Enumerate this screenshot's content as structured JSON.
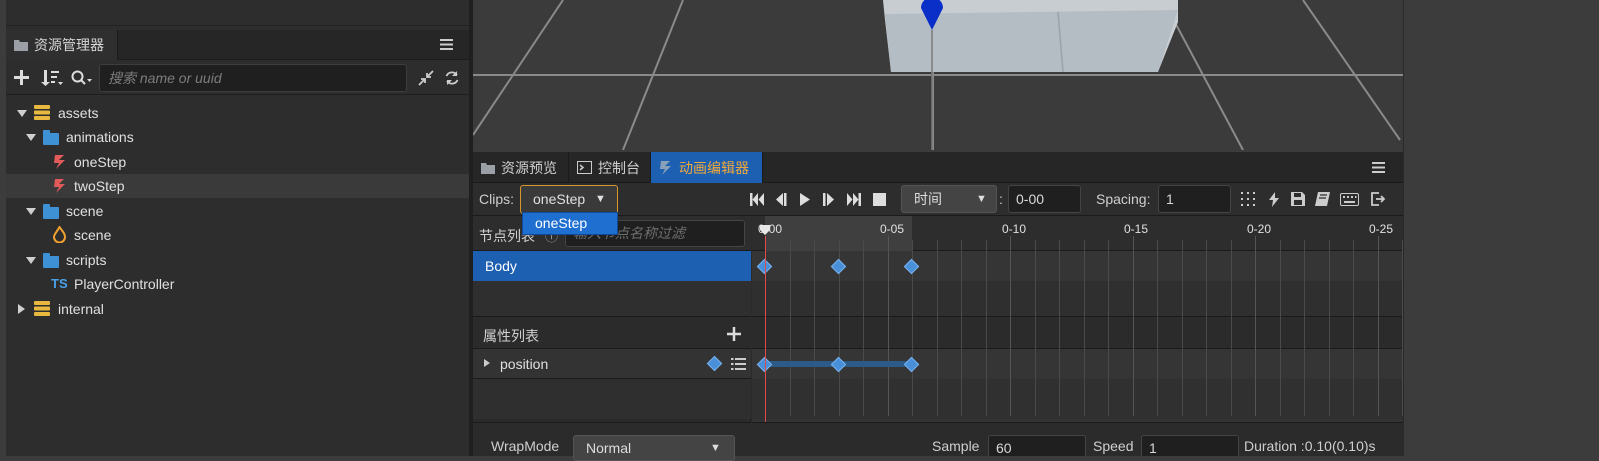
{
  "left_panel": {
    "tab_title": "资源管理器",
    "search_placeholder": "搜索 name or uuid",
    "tree": [
      {
        "label": "assets",
        "level": 0,
        "expanded": true,
        "icon": "db-icon"
      },
      {
        "label": "animations",
        "level": 1,
        "expanded": true,
        "icon": "folder-icon"
      },
      {
        "label": "oneStep",
        "level": 2,
        "icon": "anim-clip-icon"
      },
      {
        "label": "twoStep",
        "level": 2,
        "icon": "anim-clip-icon",
        "selected": true
      },
      {
        "label": "scene",
        "level": 1,
        "expanded": true,
        "icon": "folder-icon"
      },
      {
        "label": "scene",
        "level": 2,
        "icon": "scene-icon"
      },
      {
        "label": "scripts",
        "level": 1,
        "expanded": true,
        "icon": "folder-icon"
      },
      {
        "label": "PlayerController",
        "level": 2,
        "icon": "ts-icon",
        "prefix": "TS"
      },
      {
        "label": "internal",
        "level": 0,
        "expanded": false,
        "icon": "db-icon"
      }
    ]
  },
  "anim_panel": {
    "tabs": [
      {
        "label": "资源预览",
        "active": false
      },
      {
        "label": "控制台",
        "active": false
      },
      {
        "label": "动画编辑器",
        "active": true
      }
    ],
    "clips_label": "Clips:",
    "clip_selected": "oneStep",
    "clip_options": [
      "oneStep"
    ],
    "time_mode": "时间",
    "time_sep": ":",
    "time_value": "0-00",
    "spacing_label": "Spacing:",
    "spacing_value": "1",
    "node_list_label": "节点列表",
    "node_filter_placeholder": "输入节点名称过滤",
    "nodes": [
      "Body"
    ],
    "prop_list_label": "属性列表",
    "props": [
      "position"
    ],
    "ruler": [
      "0-00",
      "0-05",
      "0-10",
      "0-15",
      "0-20",
      "0-25"
    ],
    "keyframes_sec": [
      0,
      0.03,
      0.06
    ],
    "footer": {
      "wrapmode_label": "WrapMode",
      "wrapmode_value": "Normal",
      "sample_label": "Sample",
      "sample_value": "60",
      "speed_label": "Speed",
      "speed_value": "1",
      "duration_text": "Duration :0.10(0.10)s"
    }
  },
  "colors": {
    "accent": "#1d5fb0",
    "keyframe": "#4a90d9",
    "tab_active_text": "#f2a93b",
    "playhead": "#e04a4a"
  }
}
